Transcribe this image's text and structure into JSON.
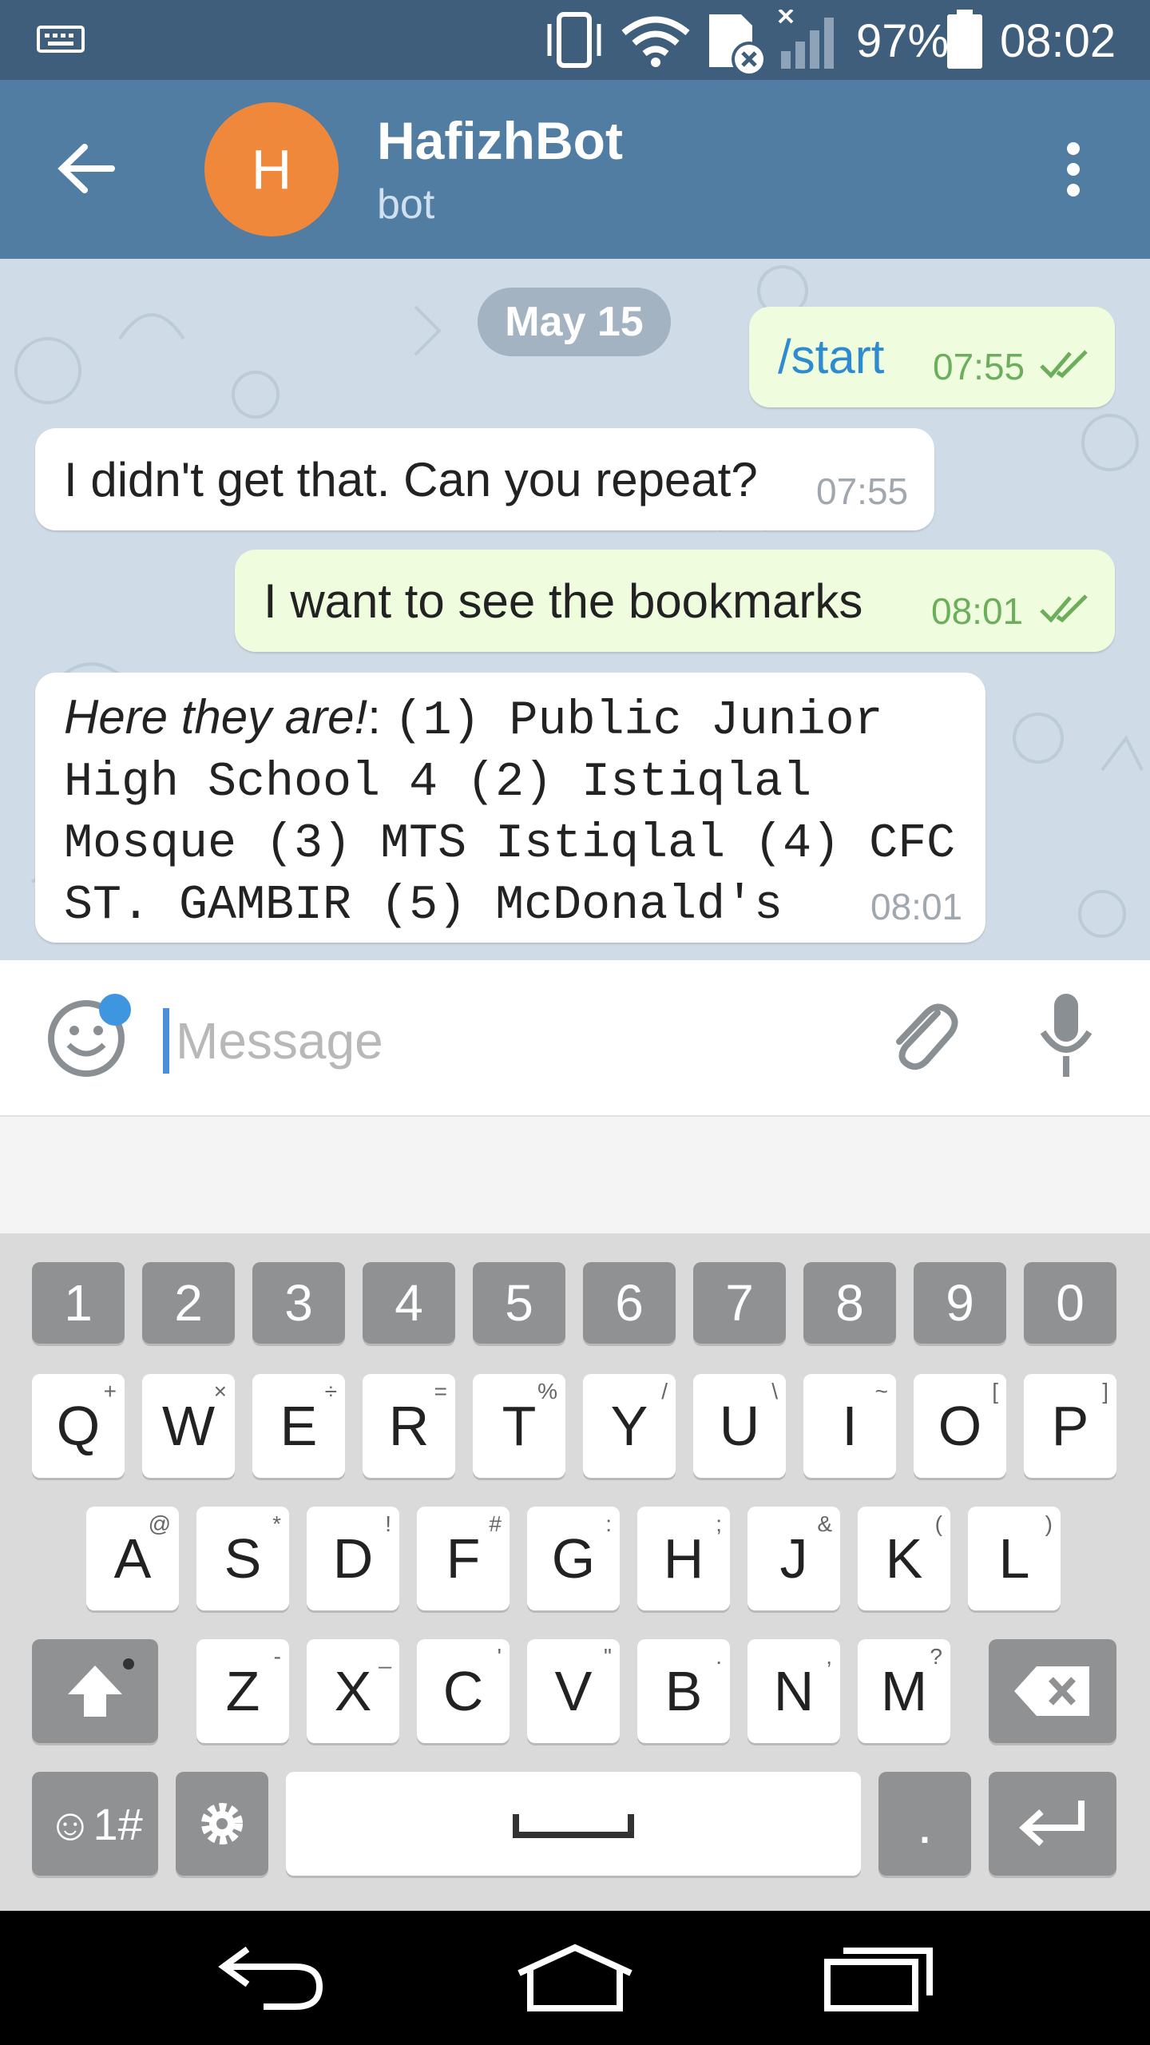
{
  "status_bar": {
    "battery_percent": "97%",
    "time": "08:02"
  },
  "header": {
    "avatar_letter": "H",
    "title": "HafizhBot",
    "subtitle": "bot"
  },
  "chat": {
    "date_chip": "May 15",
    "messages": [
      {
        "direction": "outgoing",
        "text": "/start",
        "time": "07:55"
      },
      {
        "direction": "incoming",
        "text": "I didn't get that. Can you repeat?",
        "time": "07:55"
      },
      {
        "direction": "outgoing",
        "text": "I want to see the bookmarks",
        "time": "08:01"
      },
      {
        "direction": "incoming",
        "text_italic": "Here they are!",
        "text_rest": ":",
        "text_lines": [
          "(1) Public Junior",
          "High School 4 (2) Istiqlal",
          "Mosque (3) MTS Istiqlal (4) CFC",
          "ST. GAMBIR (5) McDonald's"
        ],
        "time": "08:01"
      }
    ]
  },
  "input": {
    "placeholder": "Message"
  },
  "keyboard": {
    "numbers": [
      "1",
      "2",
      "3",
      "4",
      "5",
      "6",
      "7",
      "8",
      "9",
      "0"
    ],
    "row1": [
      {
        "k": "Q",
        "s": "+"
      },
      {
        "k": "W",
        "s": "×"
      },
      {
        "k": "E",
        "s": "÷"
      },
      {
        "k": "R",
        "s": "="
      },
      {
        "k": "T",
        "s": "%"
      },
      {
        "k": "Y",
        "s": "/"
      },
      {
        "k": "U",
        "s": "\\"
      },
      {
        "k": "I",
        "s": "~"
      },
      {
        "k": "O",
        "s": "["
      },
      {
        "k": "P",
        "s": "]"
      }
    ],
    "row2": [
      {
        "k": "A",
        "s": "@"
      },
      {
        "k": "S",
        "s": "*"
      },
      {
        "k": "D",
        "s": "!"
      },
      {
        "k": "F",
        "s": "#"
      },
      {
        "k": "G",
        "s": ":"
      },
      {
        "k": "H",
        "s": ";"
      },
      {
        "k": "J",
        "s": "&"
      },
      {
        "k": "K",
        "s": "("
      },
      {
        "k": "L",
        "s": ")"
      }
    ],
    "row3": [
      {
        "k": "Z",
        "s": "-"
      },
      {
        "k": "X",
        "s": "_"
      },
      {
        "k": "C",
        "s": "'"
      },
      {
        "k": "V",
        "s": "\""
      },
      {
        "k": "B",
        "s": "."
      },
      {
        "k": "N",
        "s": ","
      },
      {
        "k": "M",
        "s": "?"
      }
    ],
    "symbols_label": "☺1#",
    "period_label": "."
  },
  "colors": {
    "header": "#527da3",
    "status_bar": "#3f5e7c",
    "outgoing_bubble": "#effdde",
    "incoming_bubble": "#ffffff",
    "accent_blue": "#2f8bd0",
    "check_green": "#6cae5c",
    "avatar": "#f0883c"
  }
}
